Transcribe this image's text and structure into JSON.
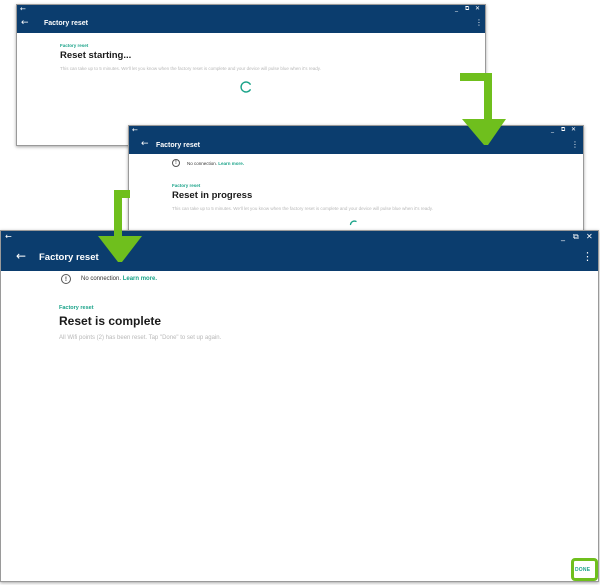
{
  "accent_color": "#1aa389",
  "header_color": "#0b3d6e",
  "highlight_color": "#6fbf1d",
  "window_1": {
    "title": "Factory reset",
    "subtitle": "Factory reset",
    "heading": "Reset starting...",
    "body": "This can take up to 5 minutes. We'll let you know when the factory reset is complete and your device will pulse blue when it's ready."
  },
  "window_2": {
    "title": "Factory reset",
    "notice": "No connection.",
    "notice_link": "Learn more.",
    "subtitle": "Factory reset",
    "heading": "Reset in progress",
    "body": "This can take up to 5 minutes. We'll let you know when the factory reset is complete and your device will pulse blue when it's ready."
  },
  "window_3": {
    "title": "Factory reset",
    "notice": "No connection.",
    "notice_link": "Learn more.",
    "subtitle": "Factory reset",
    "heading": "Reset is complete",
    "body": "All Wifi points (2) has been reset. Tap \"Done\" to set up again.",
    "done_label": "DONE"
  },
  "icons": {
    "back": "back-arrow-icon",
    "minimize": "minimize-icon",
    "restore": "restore-icon",
    "close": "close-icon",
    "menu": "more-vert-icon",
    "info": "info-icon",
    "spinner": "loading-spinner-icon",
    "callout": "green-arrow-icon"
  }
}
